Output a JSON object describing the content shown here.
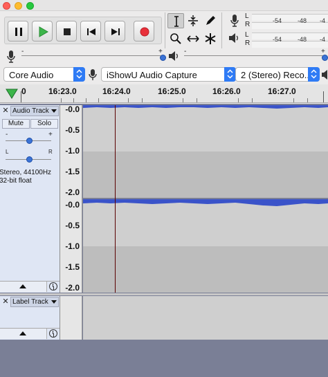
{
  "window": {
    "buttons": [
      "close",
      "minimize",
      "maximize"
    ]
  },
  "transport": {
    "buttons": [
      {
        "name": "pause",
        "icon": "pause-icon"
      },
      {
        "name": "play",
        "icon": "play-icon"
      },
      {
        "name": "stop",
        "icon": "stop-icon"
      },
      {
        "name": "skip-start",
        "icon": "skip-to-start-icon"
      },
      {
        "name": "skip-end",
        "icon": "skip-to-end-icon"
      },
      {
        "name": "record",
        "icon": "record-icon"
      }
    ]
  },
  "tools": [
    "selection-tool",
    "envelope-tool",
    "draw-tool",
    "zoom-tool",
    "time-shift-tool",
    "multi-tool"
  ],
  "meters": {
    "record_channels": [
      "L",
      "R"
    ],
    "play_channels": [
      "L",
      "R"
    ],
    "ticks": [
      "-54",
      "-48",
      "-4"
    ]
  },
  "mixer": {
    "record_level": 1.0,
    "playback_level": 1.0
  },
  "devices": {
    "host": "Core Audio",
    "recording_device": "iShowU Audio Capture",
    "channels": "2 (Stereo) Reco..."
  },
  "timeline": {
    "labels": [
      "0",
      "16:23.0",
      "16:24.0",
      "16:25.0",
      "16:26.0",
      "16:27.0"
    ]
  },
  "audio_track": {
    "name": "Audio Track",
    "mute": "Mute",
    "solo": "Solo",
    "gain_minus": "-",
    "gain_plus": "+",
    "pan_left": "L",
    "pan_right": "R",
    "format_line1": "Stereo, 44100Hz",
    "format_line2": "32-bit float",
    "ruler": [
      "-0.0",
      "-0.5",
      "-1.0",
      "-1.5",
      "-2.0"
    ]
  },
  "label_track": {
    "name": "Label Track"
  },
  "colors": {
    "waveform": "#3a53c9",
    "cursor": "#5a0000",
    "record": "#e8303a",
    "play": "#3cb54a",
    "accent": "#2f7bf5"
  }
}
